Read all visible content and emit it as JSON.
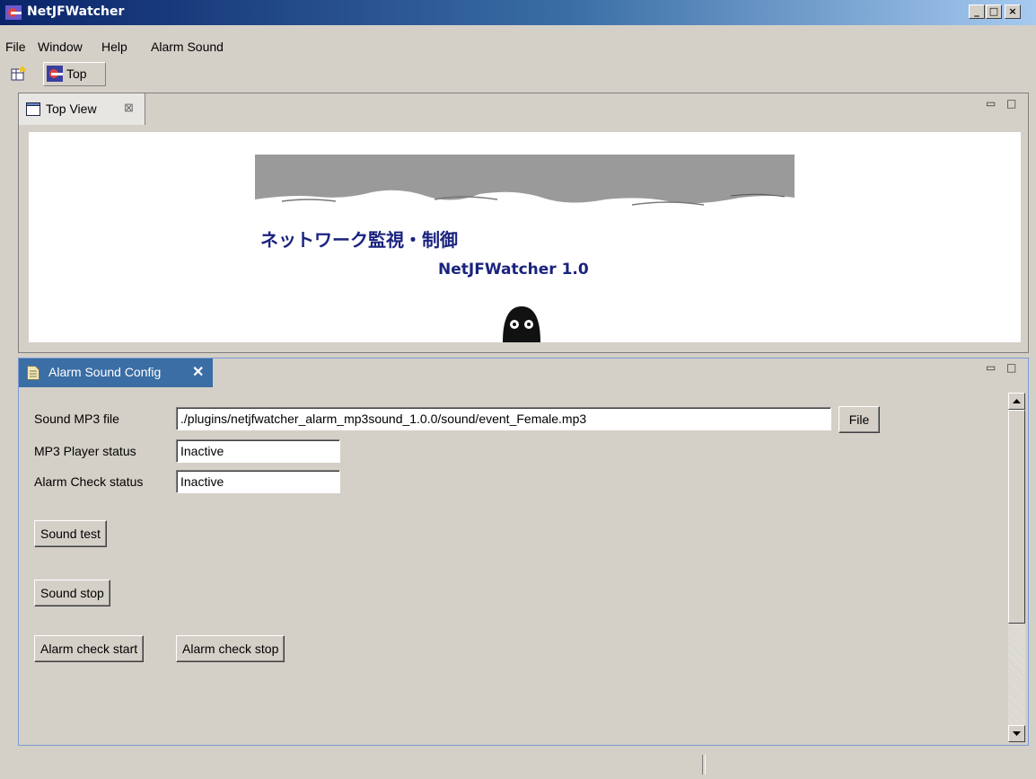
{
  "window": {
    "title": "NetJFWatcher",
    "minimize": "_",
    "maximize": "□",
    "close": "×"
  },
  "menu": [
    "File",
    "Window",
    "Help",
    "Alarm Sound"
  ],
  "toolbar": {
    "perspective_label": "Top"
  },
  "top_view": {
    "tab_label": "Top View",
    "banner_heading": "ネットワーク監視・制御",
    "banner_product": "NetJFWatcher 1.0"
  },
  "alarm_config": {
    "tab_label": "Alarm Sound Config",
    "sound_file_label": "Sound MP3 file",
    "sound_file_value": "./plugins/netjfwatcher_alarm_mp3sound_1.0.0/sound/event_Female.mp3",
    "file_button": "File",
    "player_status_label": "MP3 Player status",
    "player_status_value": "Inactive",
    "check_status_label": "Alarm Check status",
    "check_status_value": "Inactive",
    "sound_test_button": "Sound test",
    "sound_stop_button": "Sound stop",
    "alarm_start_button": "Alarm check start",
    "alarm_stop_button": "Alarm check stop"
  },
  "colors": {
    "title_start": "#0a246a",
    "title_end": "#a6caf0",
    "banner_text": "#1a237e",
    "active_tab": "#3a6ea5"
  }
}
